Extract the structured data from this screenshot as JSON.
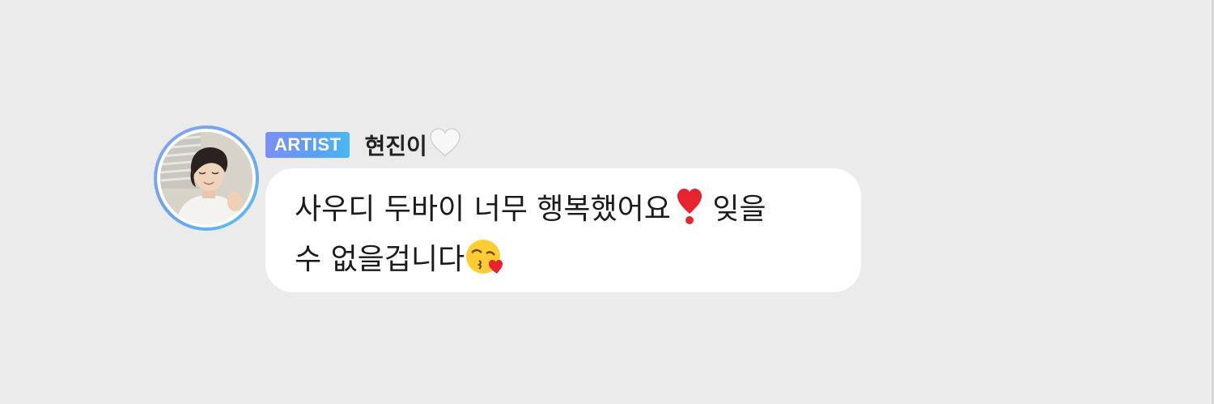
{
  "message": {
    "badge": "ARTIST",
    "username": "현진이",
    "username_emoji": "white-heart",
    "text_line1": "사우디 두바이 너무 행복했어요",
    "text_line1_emoji": "heavy-exclamation-heart",
    "text_line1_end": " 잊을",
    "text_line2": "수 없을겁니다",
    "text_line2_emoji": "kissing-face-with-heart"
  },
  "colors": {
    "background": "#ebebeb",
    "bubble": "#ffffff",
    "badge_gradient_start": "#7b8ff7",
    "badge_gradient_end": "#49b8ee",
    "text": "#1b1b1b"
  }
}
